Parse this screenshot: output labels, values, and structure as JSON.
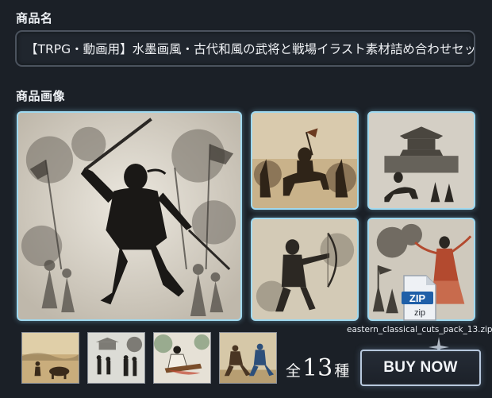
{
  "product": {
    "name_label": "商品名",
    "name_value": "【TRPG・動画用】水墨画風・古代和風の武将と戦場イラスト素材詰め合わせセット",
    "images_label": "商品画像"
  },
  "images": {
    "main": "ink-warrior-with-sword",
    "grid": [
      "general-on-horse",
      "castle-battle",
      "archer-drawing-bow",
      "dancer-over-battlefield"
    ],
    "thumbs": [
      "farmer-with-ox",
      "courtyard-figures",
      "musician-playing-zither",
      "two-martial-artists"
    ]
  },
  "download": {
    "zip_label": "ZIP",
    "zip_ext": "zip",
    "file_name": "eastern_classical_cuts_pack_13.zip"
  },
  "count": {
    "prefix": "全",
    "number": "13",
    "suffix": "種"
  },
  "buy_button": {
    "label": "BUY NOW"
  },
  "colors": {
    "background": "#1b2027",
    "frame_glow": "#9fd9f0",
    "button_border": "#b7c8dd"
  }
}
